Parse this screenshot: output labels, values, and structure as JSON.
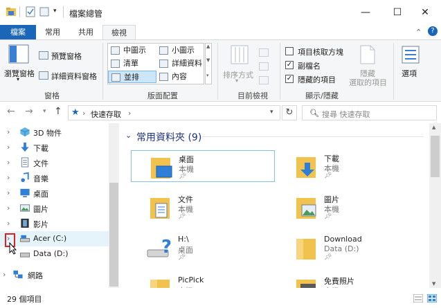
{
  "window": {
    "title": "檔案總管",
    "controls": {
      "minimize": "—",
      "maximize": "☐",
      "close": "✕"
    }
  },
  "tabs": [
    "檔案",
    "常用",
    "共用",
    "檢視"
  ],
  "ribbon": {
    "panes": {
      "nav_pane_label": "瀏覽窗格",
      "preview_pane": "預覽窗格",
      "details_pane": "詳細資料窗格",
      "group": "窗格"
    },
    "layout": {
      "items": [
        "中圖示",
        "小圖示",
        "清單",
        "詳細資料",
        "並排",
        "內容"
      ],
      "group": "版面配置"
    },
    "current_view": {
      "sort_by": "排序方式",
      "group": "目前檢視"
    },
    "show_hide": {
      "item_checkboxes": "項目核取方塊",
      "file_extensions": "副檔名",
      "hidden_items": "隱藏的項目",
      "hide_selected_1": "隱藏",
      "hide_selected_2": "選取的項目",
      "group": "顯示/隱藏",
      "checked": {
        "item_checkboxes": false,
        "file_extensions": true,
        "hidden_items": true
      }
    },
    "options": "選項",
    "collapse_icon": "chevron-up-icon",
    "help_icon": "?"
  },
  "address": {
    "path": "快速存取",
    "search_placeholder": "搜尋 快速存取",
    "sep": "›"
  },
  "nav": [
    {
      "label": "3D 物件",
      "icon": "3d-objects-icon"
    },
    {
      "label": "下載",
      "icon": "download-icon"
    },
    {
      "label": "文件",
      "icon": "document-icon"
    },
    {
      "label": "音樂",
      "icon": "music-icon"
    },
    {
      "label": "桌面",
      "icon": "desktop-icon"
    },
    {
      "label": "圖片",
      "icon": "pictures-icon"
    },
    {
      "label": "影片",
      "icon": "video-icon"
    },
    {
      "label": "Acer (C:)",
      "icon": "drive-icon"
    },
    {
      "label": "Data (D:)",
      "icon": "drive-icon"
    },
    {
      "label": "網路",
      "icon": "network-icon"
    }
  ],
  "content": {
    "group_title": "常用資料夾 (9)",
    "tiles": [
      {
        "name": "桌面",
        "sub": "本機"
      },
      {
        "name": "下載",
        "sub": "本機"
      },
      {
        "name": "文件",
        "sub": "本機"
      },
      {
        "name": "圖片",
        "sub": "本機"
      },
      {
        "name": "H:\\",
        "sub": "桌面"
      },
      {
        "name": "Download",
        "sub": "Data (D:)"
      },
      {
        "name": "PicPick",
        "sub": "本機"
      },
      {
        "name": "免費照片",
        "sub": "本機"
      }
    ]
  },
  "status": {
    "count": "29 個項目"
  }
}
